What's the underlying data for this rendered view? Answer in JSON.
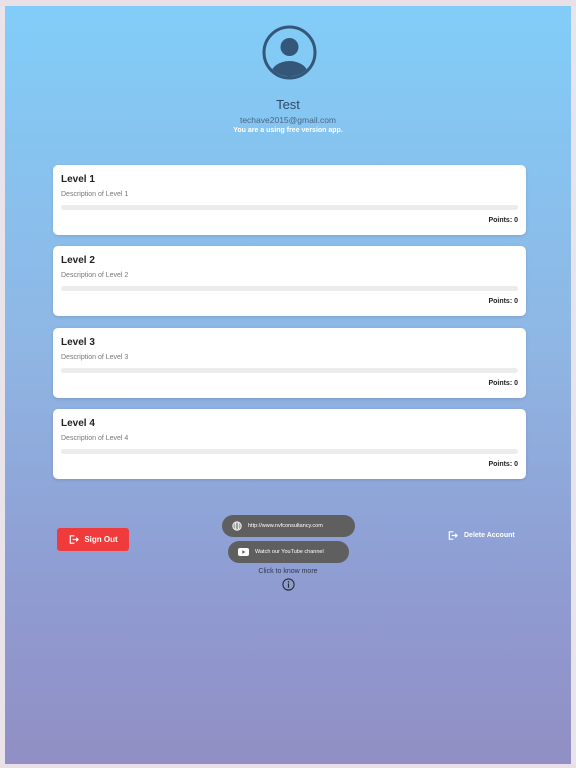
{
  "profile": {
    "name": "Test",
    "email": "techave2015@gmail.com",
    "version_note": "You are a using free version app."
  },
  "levels": [
    {
      "title": "Level 1",
      "description": "Description of Level 1",
      "points_label": "Points: 0",
      "progress": 0
    },
    {
      "title": "Level 2",
      "description": "Description of Level 2",
      "points_label": "Points: 0",
      "progress": 0
    },
    {
      "title": "Level 3",
      "description": "Description of Level 3",
      "points_label": "Points: 0",
      "progress": 0
    },
    {
      "title": "Level 4",
      "description": "Description of Level 4",
      "points_label": "Points: 0",
      "progress": 0
    }
  ],
  "actions": {
    "sign_out_label": "Sign Out",
    "website_label": "http://www.nvfconsultancy.com",
    "youtube_label": "Watch our YouTube channel",
    "know_more_label": "Click to know more",
    "delete_label": "Delete Account"
  },
  "colors": {
    "gradient_top": "#81cdf8",
    "gradient_bottom": "#918fc4",
    "sign_out": "#ef3b3b",
    "pill": "#5f5f5f"
  },
  "icons": {
    "avatar": "account-circle-icon",
    "sign_out": "logout-icon",
    "website": "globe-icon",
    "youtube": "youtube-play-icon",
    "info": "info-icon",
    "delete": "logout-icon"
  }
}
